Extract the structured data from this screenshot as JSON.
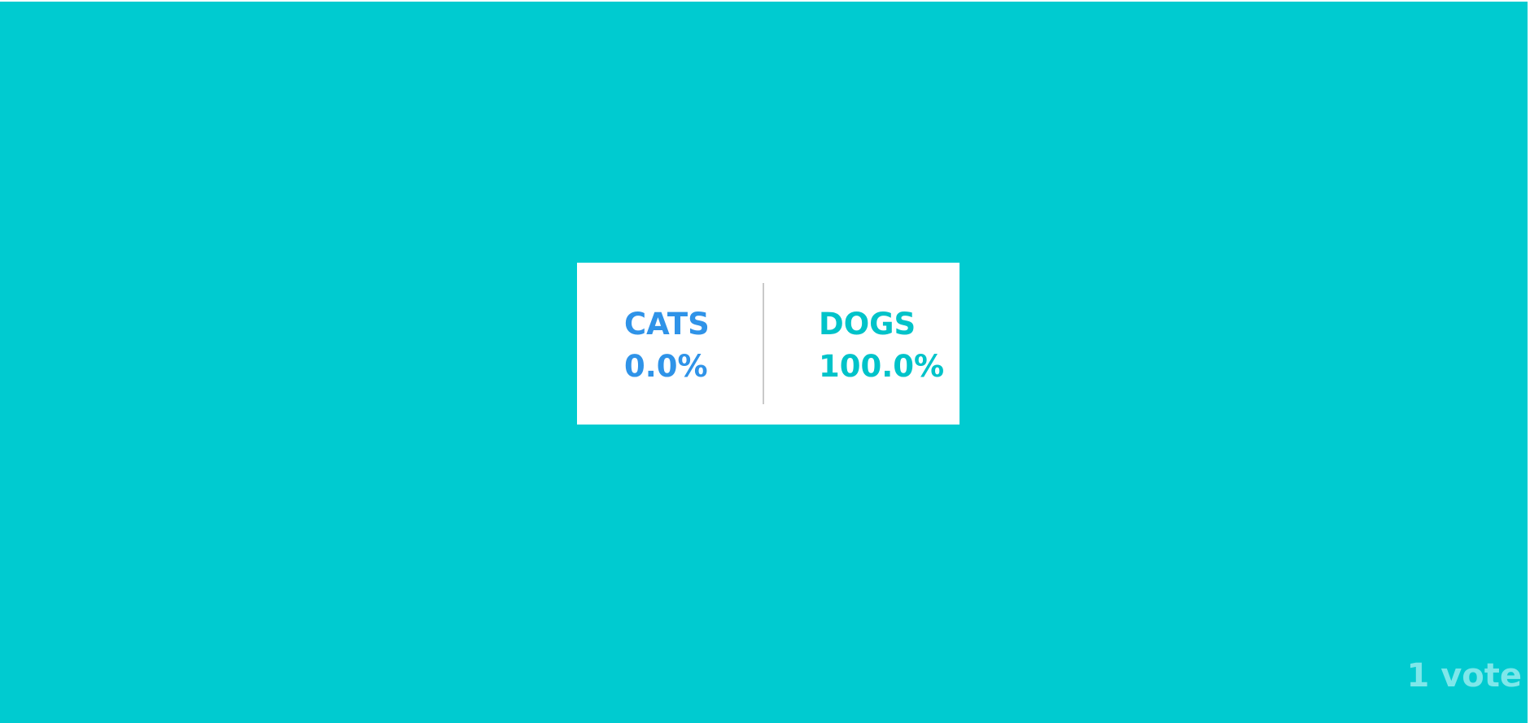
{
  "colors": {
    "background": "#00cbd0",
    "card": "#ffffff",
    "cats_accent": "#2f93e8",
    "dogs_accent": "#00c3c9",
    "divider": "#c9c9c9",
    "vote_text": "#7ee7ea"
  },
  "results": {
    "cats": {
      "label": "CATS",
      "percentage": "0.0%"
    },
    "dogs": {
      "label": "DOGS",
      "percentage": "100.0%"
    }
  },
  "footer": {
    "vote_count": "1 vote"
  }
}
